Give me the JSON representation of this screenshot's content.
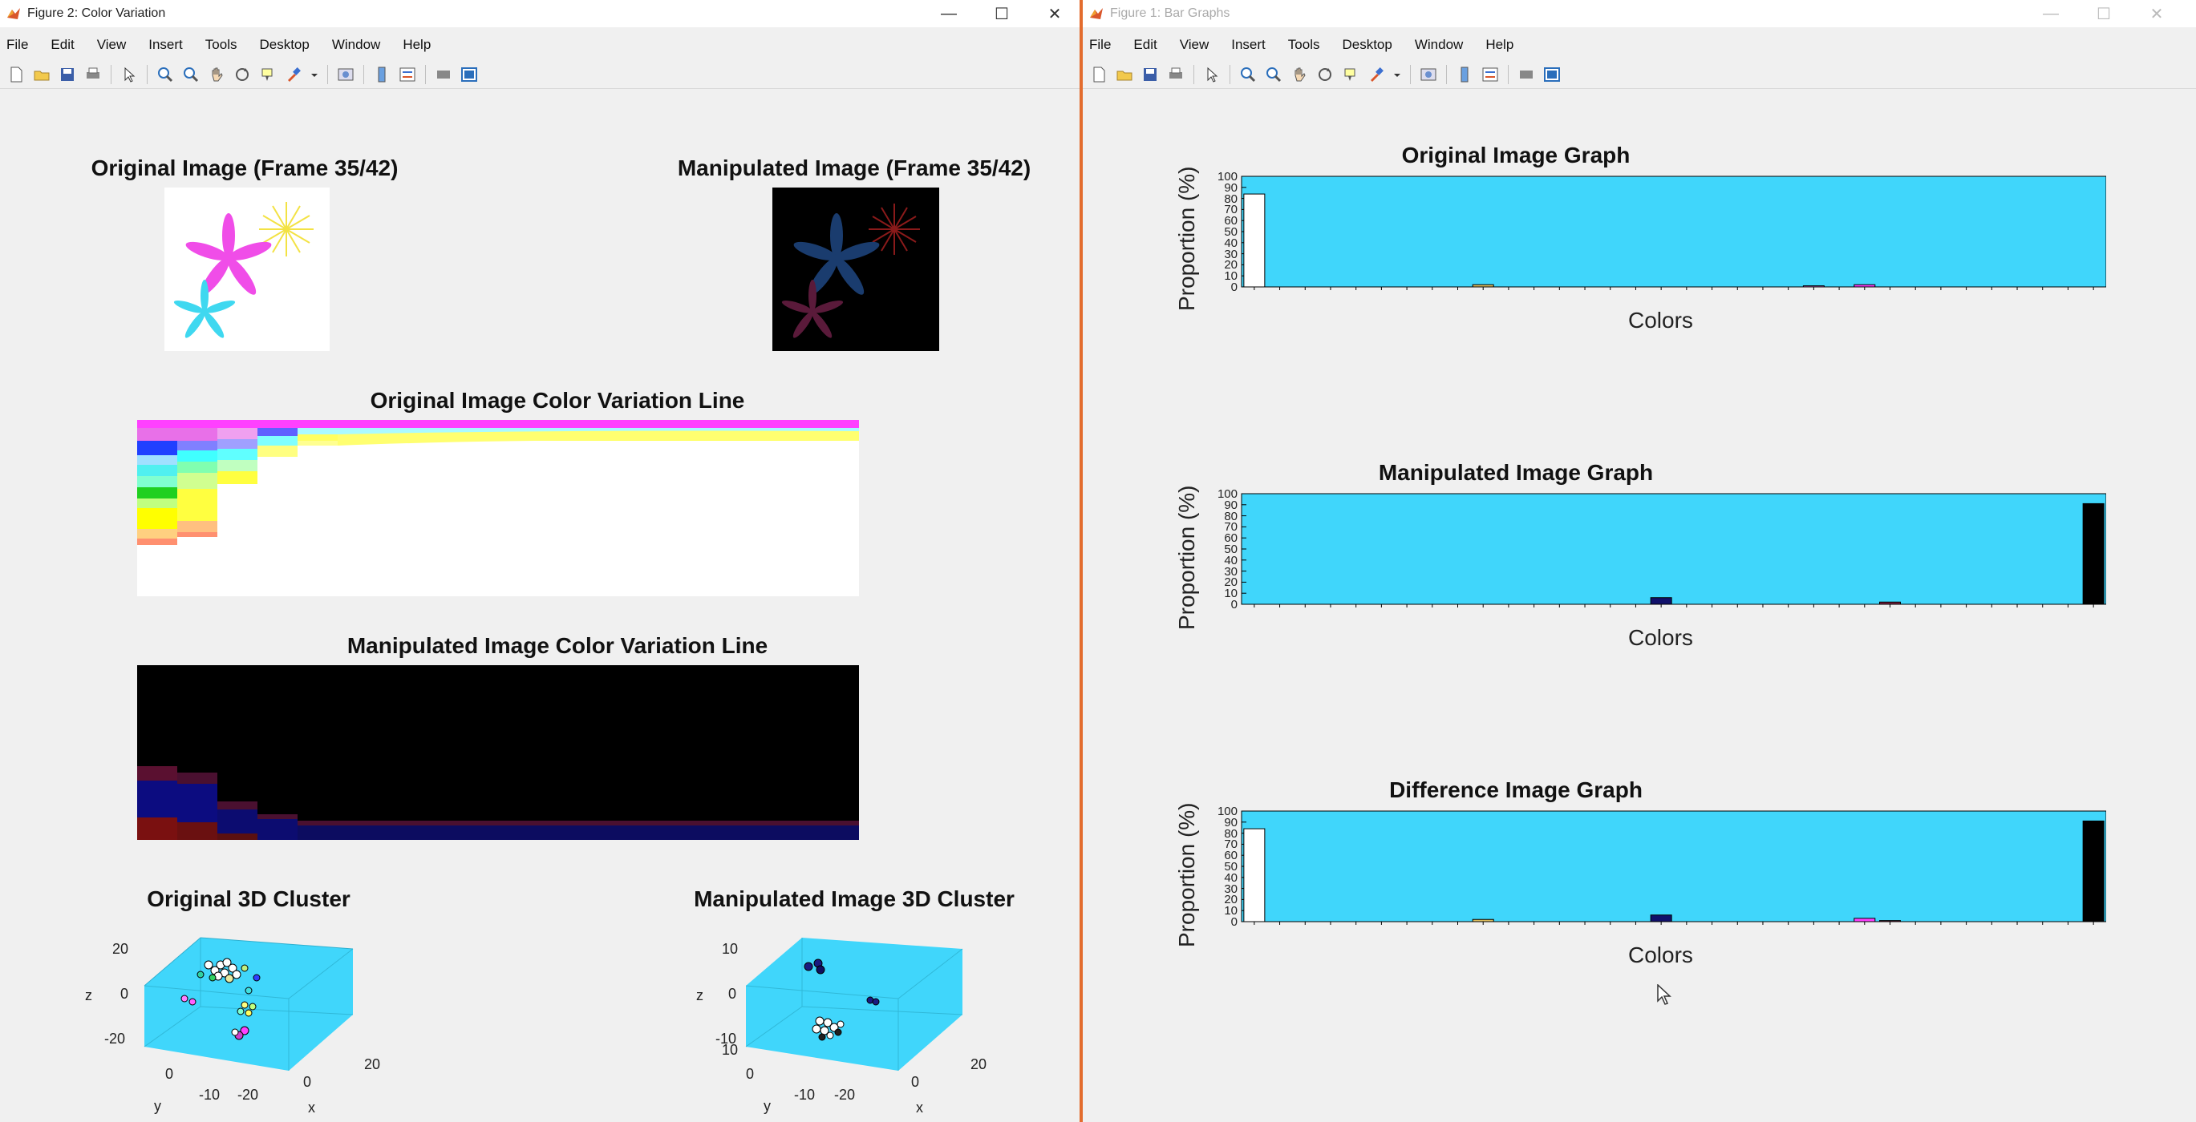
{
  "left_window": {
    "title": "Figure 2: Color Variation",
    "menu": [
      "File",
      "Edit",
      "View",
      "Insert",
      "Tools",
      "Desktop",
      "Window",
      "Help"
    ],
    "orig_image_title": "Original Image (Frame 35/42)",
    "manip_image_title": "Manipulated Image (Frame 35/42)",
    "orig_line_title": "Original Image Color Variation Line",
    "manip_line_title": "Manipulated Image Color Variation Line",
    "orig_cluster_title": "Original 3D Cluster",
    "manip_cluster_title": "Manipulated Image 3D Cluster",
    "orig_cluster": {
      "z_ticks": [
        "20",
        "0",
        "-20"
      ],
      "y_ticks": [
        "0",
        "-10",
        "-20"
      ],
      "x_ticks": [
        "0",
        "20"
      ],
      "labels": {
        "z": "z",
        "y": "y",
        "x": "x"
      }
    },
    "manip_cluster": {
      "z_ticks": [
        "10",
        "0",
        "-10"
      ],
      "y_ticks": [
        "10",
        "0",
        "-10",
        "-20"
      ],
      "x_ticks": [
        "0",
        "20"
      ],
      "labels": {
        "z": "z",
        "y": "y",
        "x": "x"
      }
    }
  },
  "right_window": {
    "title": "Figure 1: Bar Graphs",
    "menu": [
      "File",
      "Edit",
      "View",
      "Insert",
      "Tools",
      "Desktop",
      "Window",
      "Help"
    ],
    "y_axis_label": "Proportion (%)",
    "x_axis_label": "Colors",
    "y_ticks": [
      "100",
      "90",
      "80",
      "70",
      "60",
      "50",
      "40",
      "30",
      "20",
      "10",
      "0"
    ]
  },
  "colors": {
    "plot_bg": "#40d6fb",
    "separator": "#e36c2e"
  },
  "chart_data": [
    {
      "type": "bar",
      "title": "Original Image Graph",
      "xlabel": "Colors",
      "ylabel": "Proportion (%)",
      "ylim": [
        0,
        100
      ],
      "categories_count": 34,
      "values": [
        84,
        0,
        0,
        0,
        0,
        0,
        0,
        0,
        0,
        0,
        0,
        0,
        0,
        0,
        0,
        0,
        0,
        0,
        0,
        0,
        0,
        0,
        0,
        0,
        0,
        0,
        0,
        0,
        0,
        0,
        0,
        0,
        0,
        0
      ],
      "highlights": [
        {
          "index": 9,
          "value": 2,
          "color": "#e0c060"
        },
        {
          "index": 22,
          "value": 1,
          "color": "#cc66cc"
        },
        {
          "index": 24,
          "value": 2,
          "color": "#ff40ff"
        }
      ],
      "bar_colors": [
        "#ffffff"
      ]
    },
    {
      "type": "bar",
      "title": "Manipulated Image Graph",
      "xlabel": "Colors",
      "ylabel": "Proportion (%)",
      "ylim": [
        0,
        100
      ],
      "categories_count": 34,
      "values": [
        0,
        0,
        0,
        0,
        0,
        0,
        0,
        0,
        0,
        0,
        0,
        0,
        0,
        0,
        0,
        0,
        0,
        0,
        0,
        0,
        0,
        0,
        0,
        0,
        0,
        0,
        0,
        0,
        0,
        0,
        0,
        0,
        0,
        91
      ],
      "highlights": [
        {
          "index": 16,
          "value": 6,
          "color": "#10106a"
        },
        {
          "index": 25,
          "value": 2,
          "color": "#7a2040"
        }
      ],
      "bar_colors": [
        "#000000"
      ]
    },
    {
      "type": "bar",
      "title": "Difference Image Graph",
      "xlabel": "Colors",
      "ylabel": "Proportion (%)",
      "ylim": [
        0,
        100
      ],
      "categories_count": 34,
      "values": [
        84,
        0,
        0,
        0,
        0,
        0,
        0,
        0,
        0,
        0,
        0,
        0,
        0,
        0,
        0,
        0,
        0,
        0,
        0,
        0,
        0,
        0,
        0,
        0,
        0,
        0,
        0,
        0,
        0,
        0,
        0,
        0,
        0,
        91
      ],
      "highlights": [
        {
          "index": 9,
          "value": 2,
          "color": "#e0c060"
        },
        {
          "index": 16,
          "value": 6,
          "color": "#10106a"
        },
        {
          "index": 24,
          "value": 3,
          "color": "#ff40ff"
        },
        {
          "index": 25,
          "value": 1,
          "color": "#7a2040"
        }
      ],
      "bar_colors": [
        "#ffffff",
        "#000000"
      ]
    }
  ]
}
